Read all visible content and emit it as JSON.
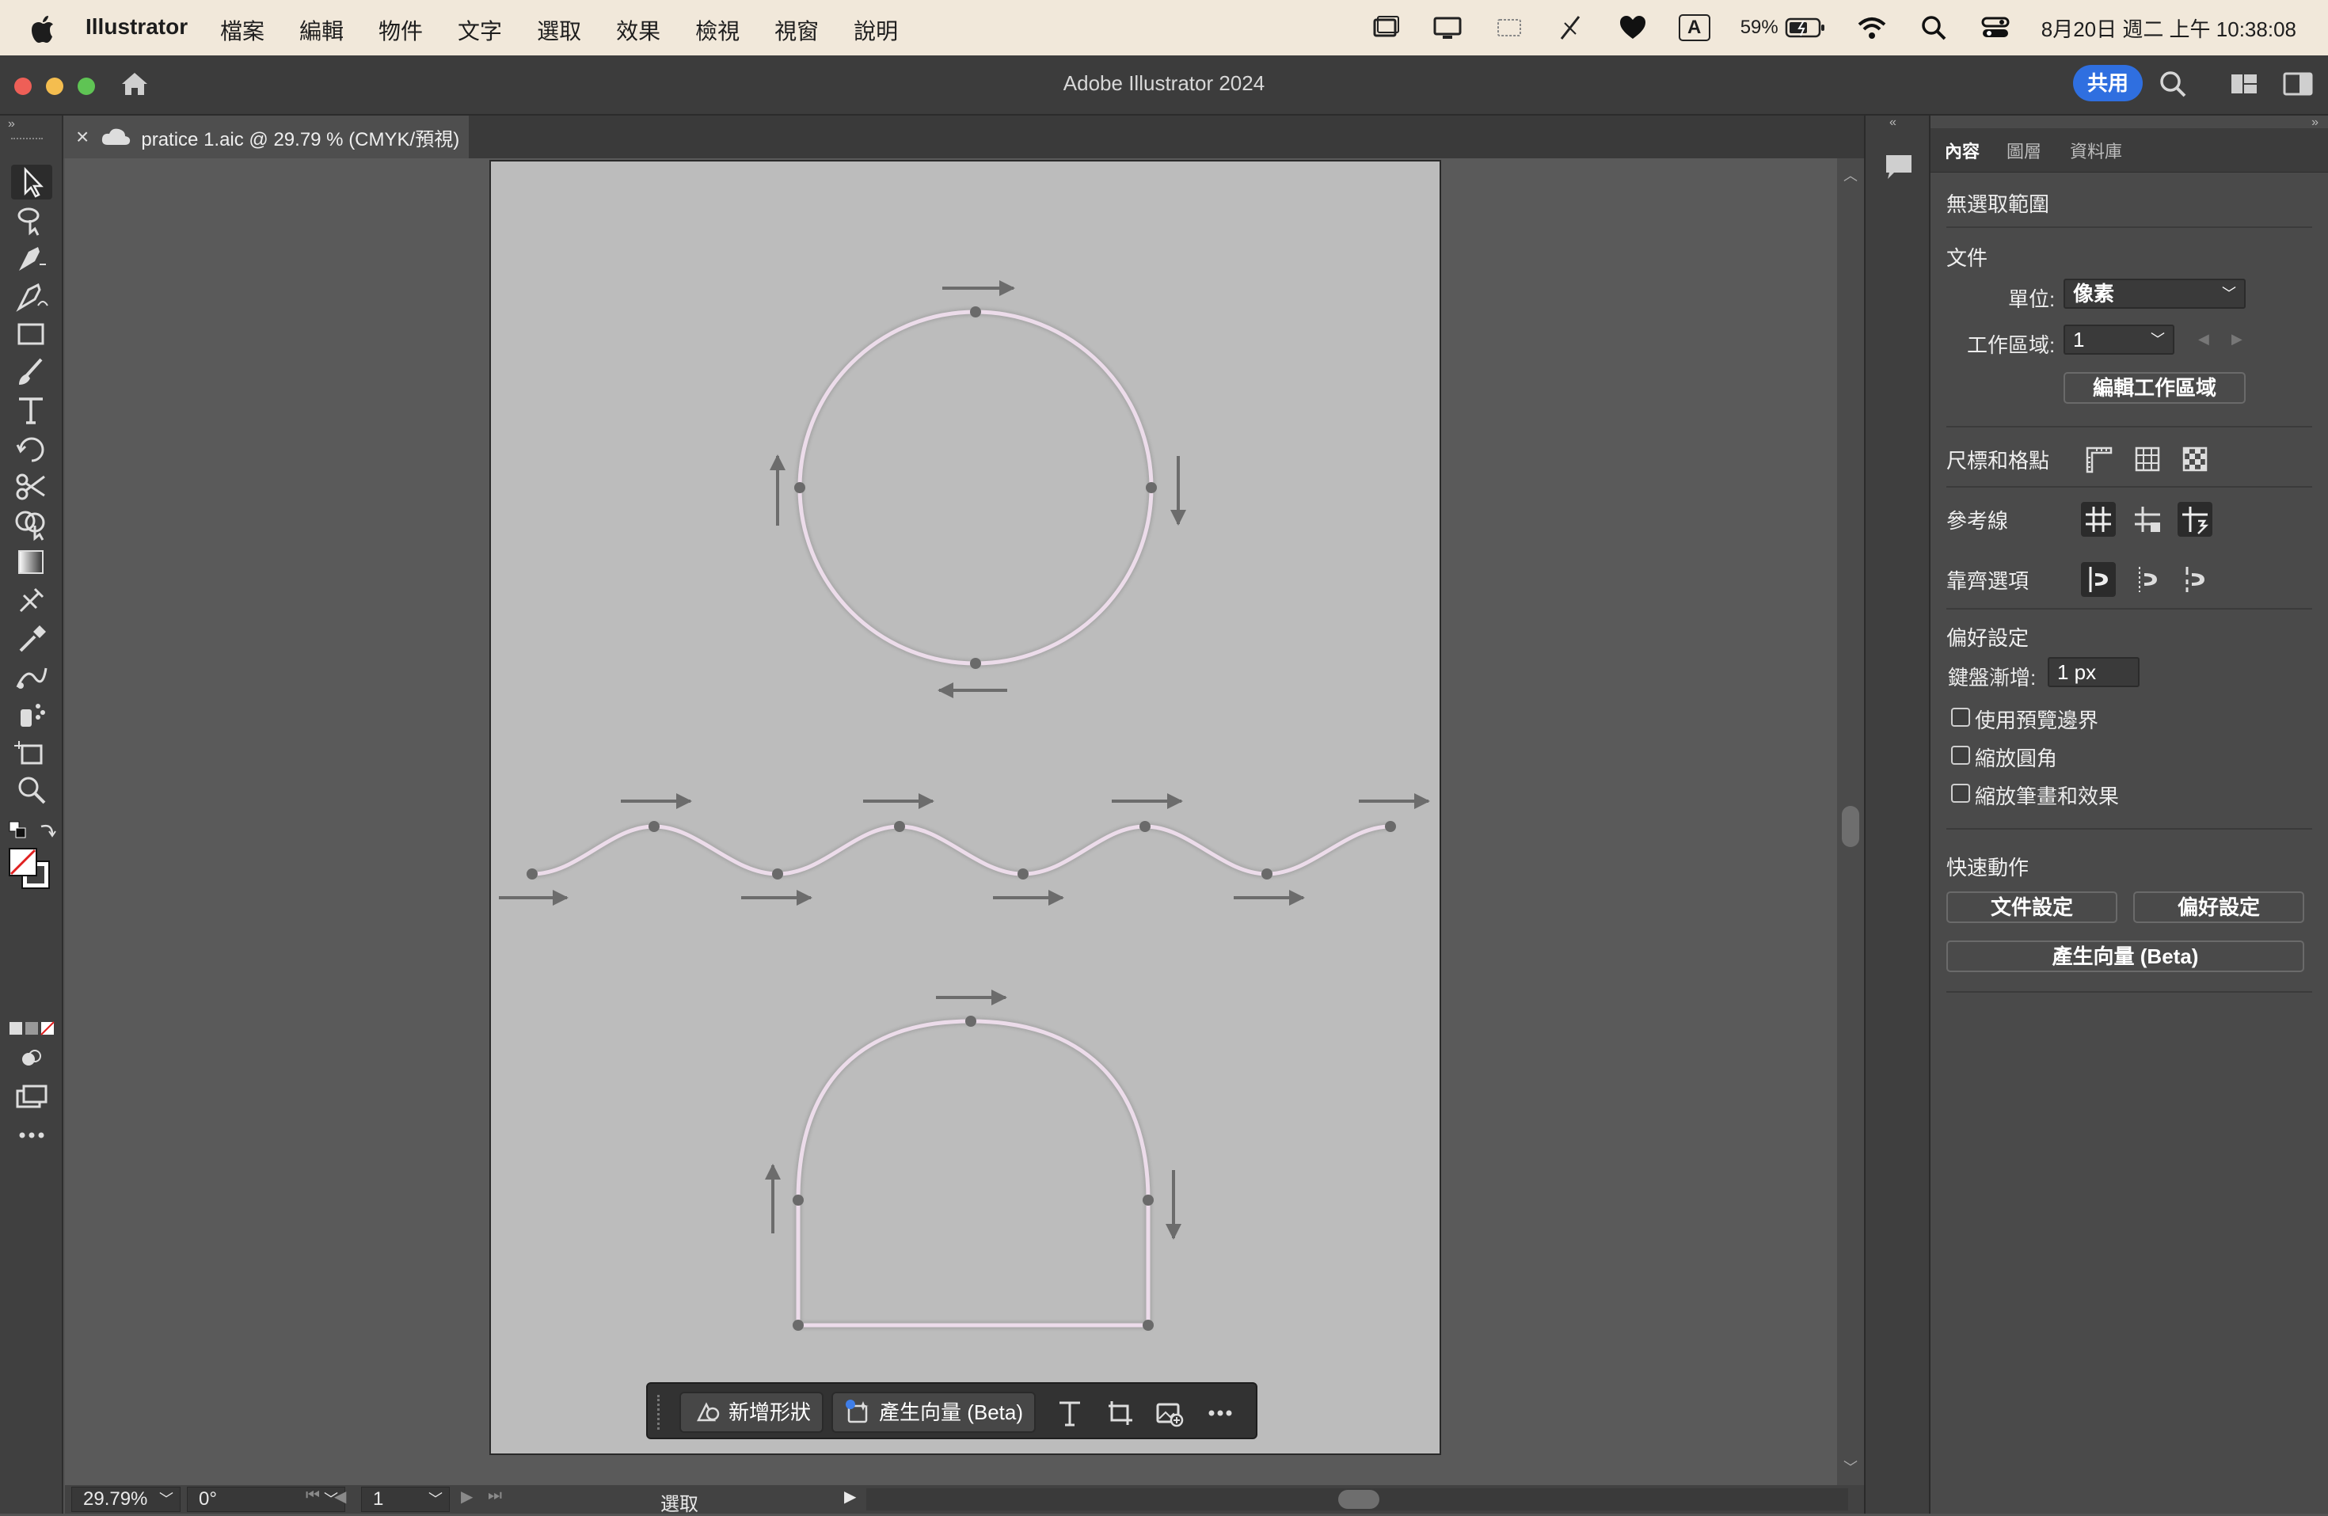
{
  "menubar": {
    "app_name": "Illustrator",
    "menus": [
      "檔案",
      "編輯",
      "物件",
      "文字",
      "選取",
      "效果",
      "檢視",
      "視窗",
      "說明"
    ],
    "battery": "59%",
    "datetime": "8月20日 週二 上午 10:38:08",
    "input_indicator": "A"
  },
  "window": {
    "title": "Adobe Illustrator 2024",
    "share_label": "共用"
  },
  "document": {
    "tab_label": "pratice 1.aic @ 29.79 % (CMYK/預視)",
    "close_glyph": "×"
  },
  "context_bar": {
    "new_shape_label": "新增形狀",
    "generate_vector_label": "產生向量 (Beta)"
  },
  "status": {
    "zoom": "29.79%",
    "rotation": "0°",
    "artboard_number": "1",
    "selection_tool": "選取"
  },
  "panel": {
    "tabs": [
      "內容",
      "圖層",
      "資料庫"
    ],
    "no_selection": "無選取範圍",
    "document_section": "文件",
    "units_label": "單位:",
    "units_value": "像素",
    "artboard_label": "工作區域:",
    "artboard_value": "1",
    "edit_artboards": "編輯工作區域",
    "rulers_grids": "尺標和格點",
    "guides": "參考線",
    "snap_options": "靠齊選項",
    "preferences_section": "偏好設定",
    "keyboard_increment_label": "鍵盤漸增:",
    "keyboard_increment_value": "1 px",
    "use_preview_bounds": "使用預覽邊界",
    "scale_corners": "縮放圓角",
    "scale_strokes": "縮放筆畫和效果",
    "quick_actions": "快速動作",
    "document_setup": "文件設定",
    "preferences_button": "偏好設定",
    "generate_vector": "產生向量 (Beta)"
  },
  "colors": {
    "menubar_bg": "#f1e8da",
    "accent": "#2f6fe0",
    "artboard": "#bcbcbc",
    "path_stroke": "#ecdcea",
    "arrow": "#6c6c6c"
  }
}
